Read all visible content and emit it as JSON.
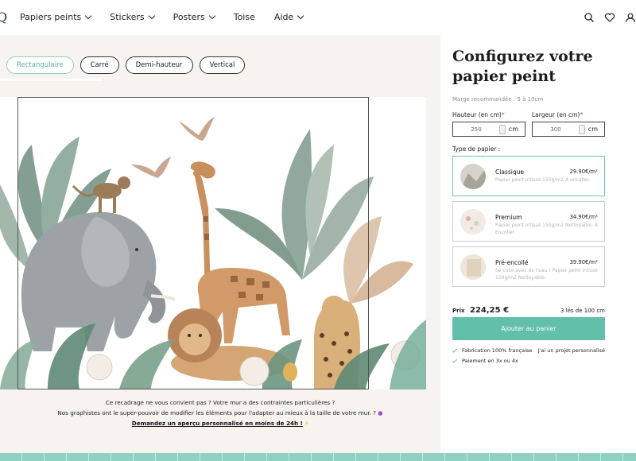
{
  "nav": {
    "logo": "Q",
    "items": [
      {
        "label": "Papiers peints",
        "dropdown": true
      },
      {
        "label": "Stickers",
        "dropdown": true
      },
      {
        "label": "Posters",
        "dropdown": true
      },
      {
        "label": "Toise",
        "dropdown": false
      },
      {
        "label": "Aide",
        "dropdown": true
      }
    ],
    "icons": [
      "search-icon",
      "heart-icon",
      "user-icon"
    ]
  },
  "shapes": {
    "tabs": [
      "Rectangulaire",
      "Carré",
      "Demi-hauteur",
      "Vertical"
    ],
    "active": "Rectangulaire"
  },
  "note": {
    "line1": "Ce recadrage ne vous convient pas ? Votre mur a des contraintes particulières  ?",
    "line2": "Nos graphistes ont le super-pouvoir de modifier les éléments pour l'adapter au mieux à la taille de votre mur. ?",
    "link": "Demandez un aperçu personnalisé en moins de 24h !"
  },
  "config": {
    "title": "Configurez votre papier peint",
    "margin": "Marge recommandée : 5 à 10cm",
    "height": {
      "label": "Hauteur (en cm)",
      "value": "250",
      "unit": "cm"
    },
    "width": {
      "label": "Largeur (en cm)",
      "value": "300",
      "unit": "cm"
    },
    "paper_type_label": "Type de papier :",
    "papers": [
      {
        "name": "Classique",
        "price": "29.90€/m²",
        "desc": "Papier peint intissé 150g/m2 À encoller."
      },
      {
        "name": "Premium",
        "price": "34.90€/m²",
        "desc": "Papier peint intissé 150g/m2 Nettoyable. À Encoller."
      },
      {
        "name": "Pré-encollé",
        "price": "39.90€/m²",
        "desc": "Se colle avec de l'eau ! Papier peint intissé 150g/m2 Nettoyable."
      }
    ],
    "selected_paper": "Classique",
    "price_label": "Prix",
    "price": "224,25 €",
    "strips": "3 lés de 100 cm",
    "add_to_cart": "Ajouter au panier",
    "features": [
      "Fabrication 100% française",
      "Paiement en 3x ou 4x"
    ],
    "custom_project": "J'ai un projet personnalisé"
  },
  "colors": {
    "accent": "#62c0aa",
    "accent_light": "#8ed0bf",
    "panel_bg": "#f7f4ef",
    "required": "#e03a3a"
  }
}
